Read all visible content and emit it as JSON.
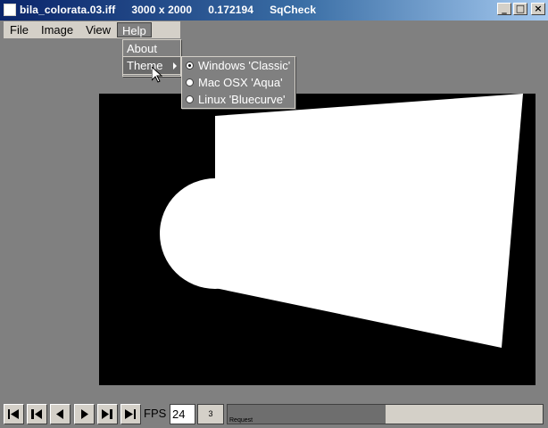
{
  "window": {
    "filename": "bila_colorata.03.iff",
    "dimensions": "3000 x 2000",
    "value": "0.172194",
    "app_name": "SqCheck",
    "minimize": "_",
    "maximize": "□",
    "close": "×"
  },
  "menubar": {
    "file": "File",
    "image": "Image",
    "view": "View",
    "help": "Help"
  },
  "help_menu": {
    "about": "About",
    "theme": "Theme"
  },
  "theme_menu": {
    "options": [
      "Windows 'Classic'",
      "Mac OSX 'Aqua'",
      "Linux 'Bluecurve'"
    ],
    "selected_index": 0
  },
  "toolbar": {
    "fps_label": "FPS",
    "fps_value": "24",
    "frame": "3",
    "progress_label": "Request",
    "progress_fraction": 0.5,
    "buttons": [
      "first-frame-icon",
      "step-back-icon",
      "play-reverse-icon",
      "play-icon",
      "step-forward-icon",
      "last-frame-icon"
    ]
  },
  "colors": {
    "background": "#808080",
    "panel": "#d4d0c8",
    "title_start": "#0a246a",
    "title_end": "#a6caf0",
    "canvas": "#000000",
    "shape": "#ffffff"
  }
}
